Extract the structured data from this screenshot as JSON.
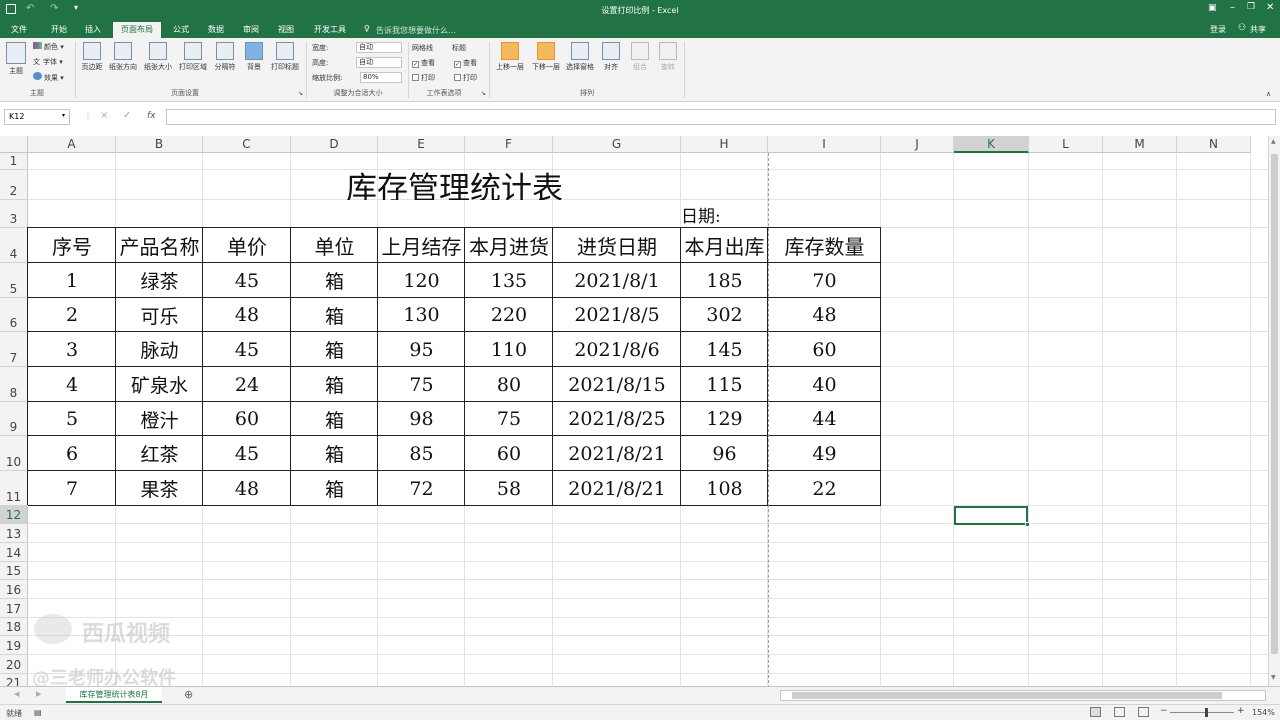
{
  "window": {
    "title": "设置打印比例 - Excel"
  },
  "account": {
    "login": "登录",
    "share": "共享"
  },
  "tabs": [
    "文件",
    "开始",
    "插入",
    "页面布局",
    "公式",
    "数据",
    "审阅",
    "视图",
    "开发工具"
  ],
  "tell_me": "告诉我您想要做什么...",
  "ribbon": {
    "theme": {
      "theme_label": "主题",
      "colors": "颜色",
      "fonts": "字体",
      "effects": "效果",
      "group": "主题"
    },
    "page_setup": {
      "margins": "页边距",
      "orientation": "纸张方向",
      "size": "纸张大小",
      "print_area": "打印区域",
      "breaks": "分隔符",
      "background": "背景",
      "print_titles": "打印标题",
      "group": "页面设置"
    },
    "scale": {
      "width_label": "宽度:",
      "width_value": "自动",
      "height_label": "高度:",
      "height_value": "自动",
      "scale_label": "缩放比例:",
      "scale_value": "80%",
      "group": "调整为合适大小"
    },
    "sheet_options": {
      "gridlines": "网格线",
      "headings": "标题",
      "view": "查看",
      "print": "打印",
      "group": "工作表选项"
    },
    "arrange": {
      "bring_forward": "上移一层",
      "send_backward": "下移一层",
      "selection_pane": "选择窗格",
      "align": "对齐",
      "group_btn": "组合",
      "rotate": "旋转",
      "group": "排列"
    }
  },
  "namebox": "K12",
  "formula_icons": {
    "cancel": "×",
    "enter": "✓",
    "fx": "fx"
  },
  "columns": [
    "A",
    "B",
    "C",
    "D",
    "E",
    "F",
    "G",
    "H",
    "I",
    "J",
    "K",
    "L",
    "M",
    "N"
  ],
  "rows": [
    "1",
    "2",
    "3",
    "4",
    "5",
    "6",
    "7",
    "8",
    "9",
    "10",
    "11",
    "12",
    "13",
    "14",
    "15",
    "16",
    "17",
    "18",
    "19",
    "20",
    "21"
  ],
  "sheet": {
    "title": "库存管理统计表",
    "date_label": "日期:",
    "headers": [
      "序号",
      "产品名称",
      "单价",
      "单位",
      "上月结存",
      "本月进货",
      "进货日期",
      "本月出库",
      "库存数量"
    ],
    "rows": [
      [
        "1",
        "绿茶",
        "45",
        "箱",
        "120",
        "135",
        "2021/8/1",
        "185",
        "70"
      ],
      [
        "2",
        "可乐",
        "48",
        "箱",
        "130",
        "220",
        "2021/8/5",
        "302",
        "48"
      ],
      [
        "3",
        "脉动",
        "45",
        "箱",
        "95",
        "110",
        "2021/8/6",
        "145",
        "60"
      ],
      [
        "4",
        "矿泉水",
        "24",
        "箱",
        "75",
        "80",
        "2021/8/15",
        "115",
        "40"
      ],
      [
        "5",
        "橙汁",
        "60",
        "箱",
        "98",
        "75",
        "2021/8/25",
        "129",
        "44"
      ],
      [
        "6",
        "红茶",
        "45",
        "箱",
        "85",
        "60",
        "2021/8/21",
        "96",
        "49"
      ],
      [
        "7",
        "果茶",
        "48",
        "箱",
        "72",
        "58",
        "2021/8/21",
        "108",
        "22"
      ]
    ]
  },
  "sheet_tab": "库存管理统计表8月",
  "status": {
    "ready": "就绪",
    "zoom": "154%"
  },
  "watermark": {
    "brand": "西瓜视频",
    "author": "@三老师办公软件"
  },
  "colors": {
    "excel_green": "#217346"
  }
}
